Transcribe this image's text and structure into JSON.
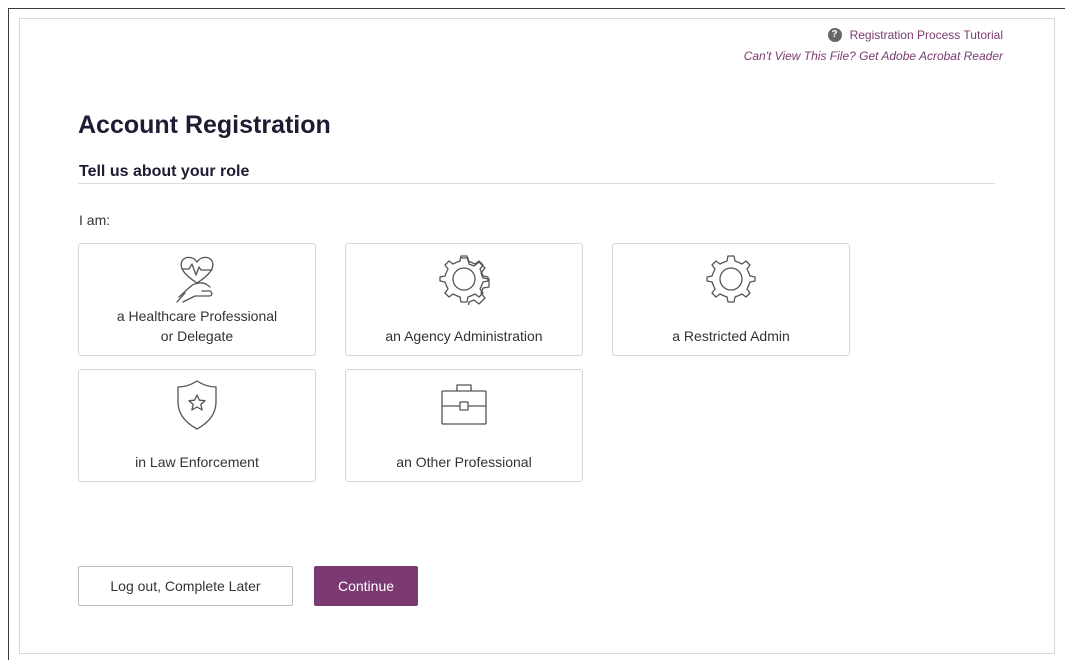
{
  "help": {
    "help_icon_glyph": "?",
    "tutorial_label": "Registration Process Tutorial",
    "acrobat_label": "Can't View This File? Get Adobe Acrobat Reader"
  },
  "page_title": "Account Registration",
  "section_title": "Tell us about your role",
  "role_prompt": "I am:",
  "roles": [
    {
      "label": "a Healthcare Professional\nor Delegate",
      "icon": "heart-hand-icon"
    },
    {
      "label": "an Agency Administration",
      "icon": "gear-icon"
    },
    {
      "label": "a Restricted Admin",
      "icon": "gear-icon"
    },
    {
      "label": "in Law Enforcement",
      "icon": "shield-star-icon"
    },
    {
      "label": "an Other Professional",
      "icon": "briefcase-icon"
    }
  ],
  "buttons": {
    "later_label": "Log out, Complete Later",
    "continue_label": "Continue"
  },
  "colors": {
    "accent": "#7b3b72",
    "title": "#1f1b32",
    "icon_stroke": "#555555"
  }
}
